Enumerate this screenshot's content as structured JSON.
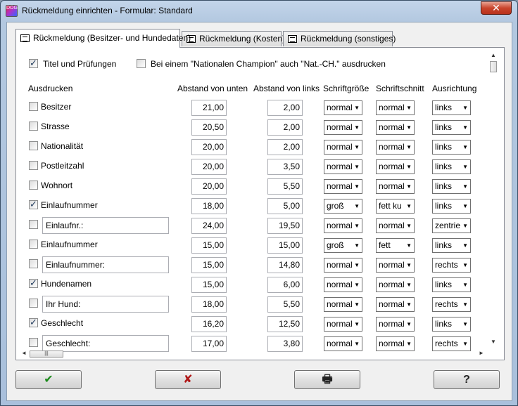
{
  "window": {
    "title": "Rückmeldung einrichten - Formular: Standard",
    "close_glyph": "✕",
    "app_icon_text": "DOG"
  },
  "tabs": [
    {
      "label": "Rückmeldung (Besitzer- und Hundedaten)",
      "active": true
    },
    {
      "label": "Rückmeldung (Kosten)",
      "active": false
    },
    {
      "label": "Rückmeldung (sonstiges)",
      "active": false
    }
  ],
  "options": {
    "titel": {
      "label": "Titel und Prüfungen",
      "checked": true
    },
    "champion": {
      "label": "Bei einem \"Nationalen Champion\" auch \"Nat.-CH.\" ausdrucken",
      "checked": false
    }
  },
  "headers": {
    "ausdrucken": "Ausdrucken",
    "abstand_unten": "Abstand von unten",
    "abstand_links": "Abstand von links",
    "schriftgroesse": "Schriftgröße",
    "schriftschnitt": "Schriftschnitt",
    "ausrichtung": "Ausrichtung"
  },
  "rows": [
    {
      "label": "Besitzer",
      "editable_label": false,
      "checked": false,
      "unten": "21,00",
      "links": "2,00",
      "groesse": "normal",
      "schnitt": "normal",
      "ausrichtung": "links"
    },
    {
      "label": "Strasse",
      "editable_label": false,
      "checked": false,
      "unten": "20,50",
      "links": "2,00",
      "groesse": "normal",
      "schnitt": "normal",
      "ausrichtung": "links"
    },
    {
      "label": "Nationalität",
      "editable_label": false,
      "checked": false,
      "unten": "20,00",
      "links": "2,00",
      "groesse": "normal",
      "schnitt": "normal",
      "ausrichtung": "links"
    },
    {
      "label": "Postleitzahl",
      "editable_label": false,
      "checked": false,
      "unten": "20,00",
      "links": "3,50",
      "groesse": "normal",
      "schnitt": "normal",
      "ausrichtung": "links"
    },
    {
      "label": "Wohnort",
      "editable_label": false,
      "checked": false,
      "unten": "20,00",
      "links": "5,50",
      "groesse": "normal",
      "schnitt": "normal",
      "ausrichtung": "links"
    },
    {
      "label": "Einlaufnummer",
      "editable_label": false,
      "checked": true,
      "unten": "18,00",
      "links": "5,00",
      "groesse": "groß",
      "schnitt": "fett ku",
      "ausrichtung": "links"
    },
    {
      "label": "Einlaufnr.:",
      "editable_label": true,
      "checked": false,
      "unten": "24,00",
      "links": "19,50",
      "groesse": "normal",
      "schnitt": "normal",
      "ausrichtung": "zentrie"
    },
    {
      "label": "Einlaufnummer",
      "editable_label": false,
      "checked": false,
      "unten": "15,00",
      "links": "15,00",
      "groesse": "groß",
      "schnitt": "fett",
      "ausrichtung": "links"
    },
    {
      "label": "Einlaufnummer:",
      "editable_label": true,
      "checked": false,
      "unten": "15,00",
      "links": "14,80",
      "groesse": "normal",
      "schnitt": "normal",
      "ausrichtung": "rechts"
    },
    {
      "label": "Hundenamen",
      "editable_label": false,
      "checked": true,
      "unten": "15,00",
      "links": "6,00",
      "groesse": "normal",
      "schnitt": "normal",
      "ausrichtung": "links"
    },
    {
      "label": "Ihr Hund:",
      "editable_label": true,
      "checked": false,
      "unten": "18,00",
      "links": "5,50",
      "groesse": "normal",
      "schnitt": "normal",
      "ausrichtung": "rechts"
    },
    {
      "label": "Geschlecht",
      "editable_label": false,
      "checked": true,
      "unten": "16,20",
      "links": "12,50",
      "groesse": "normal",
      "schnitt": "normal",
      "ausrichtung": "links"
    },
    {
      "label": "Geschlecht:",
      "editable_label": true,
      "checked": false,
      "unten": "17,00",
      "links": "3,80",
      "groesse": "normal",
      "schnitt": "normal",
      "ausrichtung": "rechts"
    }
  ],
  "scrollbar": {
    "h_thumb_grip": "|||",
    "up": "▲",
    "down": "▼",
    "left": "◄",
    "right": "►"
  },
  "dropdown_glyph": "▼",
  "buttons": {
    "ok": {
      "glyph": "✔",
      "color": "#1a8a1a"
    },
    "cancel": {
      "glyph": "✘",
      "color": "#b01818"
    },
    "print": {
      "glyph": "🖶",
      "color": "#222222"
    },
    "help": {
      "glyph": "?",
      "color": "#222222"
    }
  }
}
